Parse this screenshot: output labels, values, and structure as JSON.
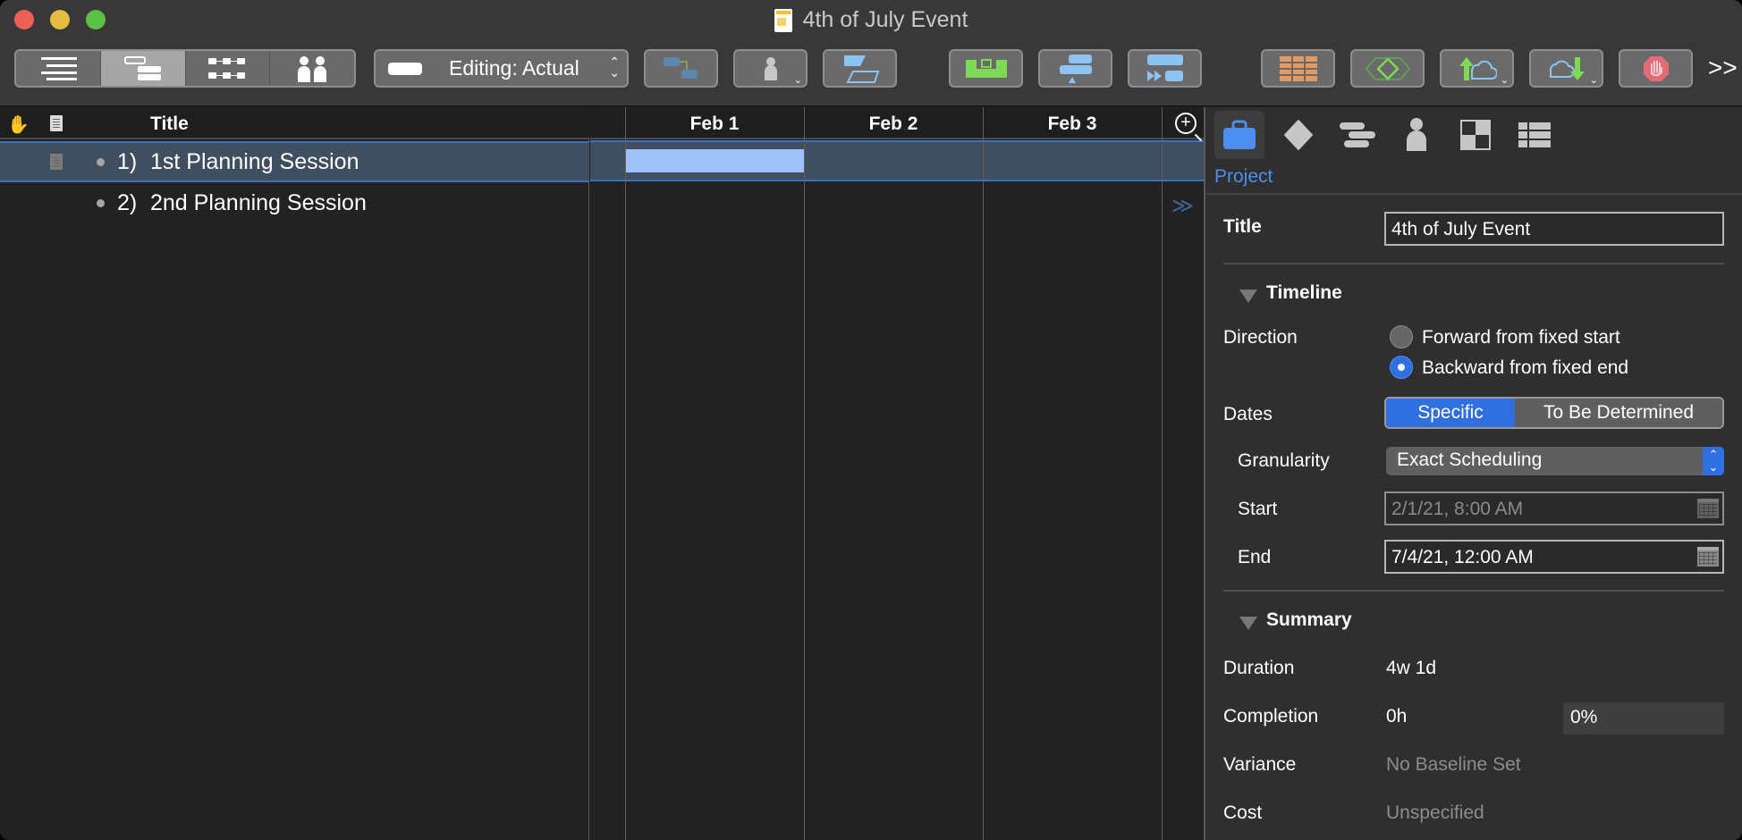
{
  "window": {
    "title": "4th of July Event",
    "doc_icon": "omniplan-document-icon"
  },
  "toolbar": {
    "view_modes": [
      {
        "name": "task-view",
        "icon": "outline-icon",
        "active": false
      },
      {
        "name": "gantt-view",
        "icon": "gantt-icon",
        "active": true
      },
      {
        "name": "network-view",
        "icon": "network-icon",
        "active": false
      },
      {
        "name": "resource-view",
        "icon": "people-icon",
        "active": false
      }
    ],
    "editing_label": "Editing: Actual",
    "buttons": [
      {
        "name": "connect-tasks",
        "icon": "connect-icon"
      },
      {
        "name": "assign-resource",
        "icon": "person-icon",
        "dropdown": true
      },
      {
        "name": "split-task",
        "icon": "split-icon"
      },
      {
        "name": "level-resources",
        "icon": "level-icon"
      },
      {
        "name": "critical-path",
        "icon": "critical-path-icon"
      },
      {
        "name": "catch-up",
        "icon": "catch-up-icon"
      },
      {
        "name": "table-view",
        "icon": "table-icon"
      },
      {
        "name": "milestone-view",
        "icon": "diamond-icon"
      },
      {
        "name": "publish",
        "icon": "cloud-upload-icon",
        "dropdown": true
      },
      {
        "name": "import",
        "icon": "cloud-download-icon",
        "dropdown": true
      },
      {
        "name": "violations",
        "icon": "stop-hand-icon"
      }
    ],
    "overflow_label": ">>"
  },
  "outline": {
    "header_title": "Title",
    "rows": [
      {
        "number": "1)",
        "title": "1st Planning Session",
        "selected": true,
        "has_note": true
      },
      {
        "number": "2)",
        "title": "2nd Planning Session",
        "selected": false,
        "has_note": false
      }
    ]
  },
  "gantt": {
    "columns": [
      "Feb 1",
      "Feb 2",
      "Feb 3"
    ],
    "bars": [
      {
        "row": 1,
        "start_day": "Feb 1",
        "duration_days": 1
      }
    ],
    "more_indicator": "≫"
  },
  "inspector": {
    "tabs": [
      {
        "name": "project",
        "icon": "briefcase-icon",
        "active": true
      },
      {
        "name": "milestone",
        "icon": "diamond-icon",
        "active": false
      },
      {
        "name": "task",
        "icon": "task-bars-icon",
        "active": false
      },
      {
        "name": "resource",
        "icon": "person-icon",
        "active": false
      },
      {
        "name": "style",
        "icon": "checker-icon",
        "active": false
      },
      {
        "name": "table",
        "icon": "list-table-icon",
        "active": false
      }
    ],
    "active_tab_label": "Project",
    "title_label": "Title",
    "title_value": "4th of July Event",
    "timeline": {
      "heading": "Timeline",
      "direction_label": "Direction",
      "direction_options": [
        "Forward from fixed start",
        "Backward from fixed end"
      ],
      "direction_selected": "Backward from fixed end",
      "dates_label": "Dates",
      "dates_options": [
        "Specific",
        "To Be Determined"
      ],
      "dates_selected": "Specific",
      "granularity_label": "Granularity",
      "granularity_value": "Exact Scheduling",
      "start_label": "Start",
      "start_value": "2/1/21, 8:00 AM",
      "end_label": "End",
      "end_value": "7/4/21, 12:00 AM"
    },
    "summary": {
      "heading": "Summary",
      "duration_label": "Duration",
      "duration_value": "4w 1d",
      "completion_label": "Completion",
      "completion_hours": "0h",
      "completion_percent": "0%",
      "variance_label": "Variance",
      "variance_value": "No Baseline Set",
      "cost_label": "Cost",
      "cost_value": "Unspecified"
    }
  }
}
